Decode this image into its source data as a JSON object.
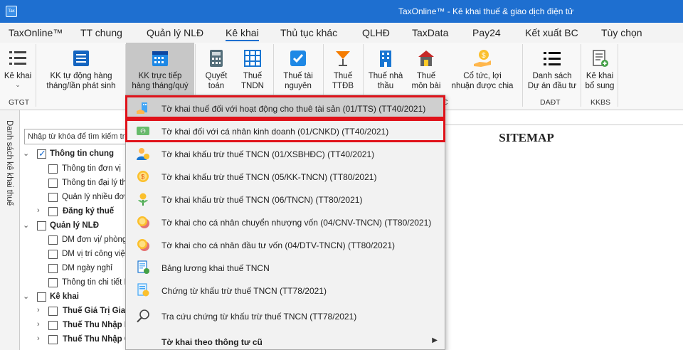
{
  "titlebar": {
    "app_icon": "Tax",
    "title": "TaxOnline™ - Kê khai thuế & giao dịch điện tử"
  },
  "menu": [
    "TaxOnline™",
    "TT chung",
    "Quản lý NLĐ",
    "Kê khai",
    "Thủ tục khác",
    "QLHĐ",
    "TaxData",
    "Pay24",
    "Kết xuất BC",
    "Tùy chọn"
  ],
  "ribbon": {
    "buttons": [
      {
        "label1": "Kê khai",
        "label2": ""
      },
      {
        "label1": "KK tự động hàng",
        "label2": "tháng/lần phát sinh"
      },
      {
        "label1": "KK trực tiếp",
        "label2": "hàng tháng/quý"
      },
      {
        "label1": "Quyết",
        "label2": "toán"
      },
      {
        "label1": "Thuế",
        "label2": "TNDN"
      },
      {
        "label1": "Thuế tài",
        "label2": "nguyên"
      },
      {
        "label1": "Thuế",
        "label2": "TTĐB"
      },
      {
        "label1": "Thuế nhà",
        "label2": "thầu"
      },
      {
        "label1": "Thuế",
        "label2": "môn bài"
      },
      {
        "label1": "Cổ tức, lợi",
        "label2": "nhuận được chia"
      },
      {
        "label1": "Danh sách",
        "label2": "Dự án đầu tư"
      },
      {
        "label1": "Kê khai",
        "label2": "bổ sung"
      }
    ],
    "groups": [
      "GTGT",
      "DAĐT",
      "KKBS"
    ],
    "chevron": "⌄",
    "partial_group_char": "C"
  },
  "left_tab": "Danh sách kê khai thuế",
  "search": {
    "value": "Nhập từ khóa để tìm kiếm trê"
  },
  "tree": [
    {
      "label": "Thông tin chung",
      "bold": true,
      "checked": true,
      "expander": "⌄"
    },
    {
      "label": "Thông tin đơn vị",
      "bold": false
    },
    {
      "label": "Thông tin đại lý thu",
      "bold": false
    },
    {
      "label": "Quản lý nhiều đơn",
      "bold": false
    },
    {
      "label": "Đăng ký thuế",
      "bold": true,
      "expander": "›"
    },
    {
      "label": "Quản lý NLĐ",
      "bold": true,
      "expander": "⌄"
    },
    {
      "label": "DM đơn vị/ phòng b",
      "bold": false
    },
    {
      "label": "DM vị trí công việc",
      "bold": false
    },
    {
      "label": "DM ngày nghỉ",
      "bold": false
    },
    {
      "label": "Thông tin chi tiết N",
      "bold": false
    },
    {
      "label": "Kê khai",
      "bold": true,
      "expander": "⌄"
    },
    {
      "label": "Thuế Giá Trị Gia",
      "bold": true,
      "expander": "›"
    },
    {
      "label": "Thuế Thu Nhập D",
      "bold": true,
      "expander": "›"
    },
    {
      "label": "Thuế Thu Nhập C",
      "bold": true,
      "expander": "›"
    }
  ],
  "sitemap": "SITEMAP",
  "dropdown": [
    {
      "label": "Tờ khai thuế đối với hoạt động cho thuê tài sản (01/TTS) (TT40/2021)",
      "icon": "building-rent-icon"
    },
    {
      "label": "Tờ khai đối với cá nhân kinh doanh (01/CNKD) (TT40/2021)",
      "icon": "money-bill-icon"
    },
    {
      "label": "Tờ khai khấu trừ thuế TNCN (01/XSBHĐC) (TT40/2021)",
      "icon": "person-coin-icon"
    },
    {
      "label": "Tờ khai khấu trừ thuế TNCN (05/KK-TNCN) (TT80/2021)",
      "icon": "coin-icon"
    },
    {
      "label": "Tờ khai khấu trừ thuế TNCN (06/TNCN) (TT80/2021)",
      "icon": "plant-coin-icon"
    },
    {
      "label": "Tờ khai cho cá nhân chuyển nhượng vốn (04/CNV-TNCN) (TT80/2021)",
      "icon": "coins-stack-icon"
    },
    {
      "label": "Tờ khai cho cá nhân đầu tư vốn (04/DTV-TNCN) (TT80/2021)",
      "icon": "coins-stack-icon"
    },
    {
      "label": "Bảng lương khai thuế TNCN",
      "icon": "payroll-icon"
    },
    {
      "label": "Chứng từ khấu trừ thuế TNCN (TT78/2021)",
      "icon": "document-coin-icon"
    },
    {
      "label": "Tra cứu chứng từ khấu trừ thuế TNCN (TT78/2021)",
      "icon": "magnifier-icon"
    },
    {
      "label": "Tờ khai theo thông tư cũ",
      "icon": "",
      "submenu_arrow": "▶"
    }
  ],
  "colors": {
    "titlebar": "#1e6fd0",
    "highlight_box": "#e0121a",
    "ribbon_selected": "#c7c7c7"
  }
}
